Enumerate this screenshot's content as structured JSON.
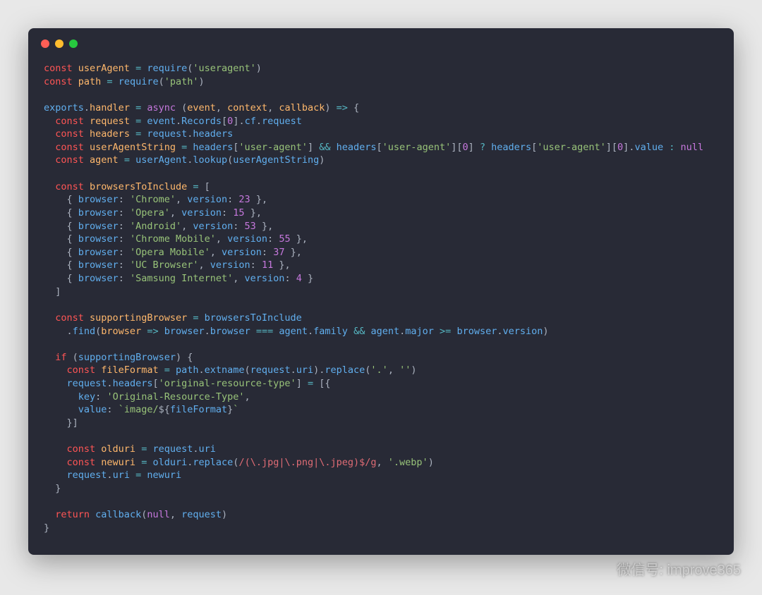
{
  "code": {
    "lines": [
      [
        {
          "c": "k",
          "t": "const "
        },
        {
          "c": "n",
          "t": "userAgent"
        },
        {
          "c": "o",
          "t": " = "
        },
        {
          "c": "b",
          "t": "require"
        },
        {
          "c": "c",
          "t": "("
        },
        {
          "c": "s",
          "t": "'useragent'"
        },
        {
          "c": "c",
          "t": ")"
        }
      ],
      [
        {
          "c": "k",
          "t": "const "
        },
        {
          "c": "n",
          "t": "path"
        },
        {
          "c": "o",
          "t": " = "
        },
        {
          "c": "b",
          "t": "require"
        },
        {
          "c": "c",
          "t": "("
        },
        {
          "c": "s",
          "t": "'path'"
        },
        {
          "c": "c",
          "t": ")"
        }
      ],
      [],
      [
        {
          "c": "b",
          "t": "exports"
        },
        {
          "c": "c",
          "t": "."
        },
        {
          "c": "n",
          "t": "handler"
        },
        {
          "c": "o",
          "t": " = "
        },
        {
          "c": "v",
          "t": "async"
        },
        {
          "c": "c",
          "t": " ("
        },
        {
          "c": "n",
          "t": "event"
        },
        {
          "c": "c",
          "t": ", "
        },
        {
          "c": "n",
          "t": "context"
        },
        {
          "c": "c",
          "t": ", "
        },
        {
          "c": "n",
          "t": "callback"
        },
        {
          "c": "c",
          "t": ") "
        },
        {
          "c": "o",
          "t": "=>"
        },
        {
          "c": "c",
          "t": " {"
        }
      ],
      [
        {
          "c": "c",
          "t": "  "
        },
        {
          "c": "k",
          "t": "const "
        },
        {
          "c": "n",
          "t": "request"
        },
        {
          "c": "o",
          "t": " = "
        },
        {
          "c": "b",
          "t": "event"
        },
        {
          "c": "c",
          "t": "."
        },
        {
          "c": "b",
          "t": "Records"
        },
        {
          "c": "c",
          "t": "["
        },
        {
          "c": "v",
          "t": "0"
        },
        {
          "c": "c",
          "t": "]."
        },
        {
          "c": "b",
          "t": "cf"
        },
        {
          "c": "c",
          "t": "."
        },
        {
          "c": "b",
          "t": "request"
        }
      ],
      [
        {
          "c": "c",
          "t": "  "
        },
        {
          "c": "k",
          "t": "const "
        },
        {
          "c": "n",
          "t": "headers"
        },
        {
          "c": "o",
          "t": " = "
        },
        {
          "c": "b",
          "t": "request"
        },
        {
          "c": "c",
          "t": "."
        },
        {
          "c": "b",
          "t": "headers"
        }
      ],
      [
        {
          "c": "c",
          "t": "  "
        },
        {
          "c": "k",
          "t": "const "
        },
        {
          "c": "n",
          "t": "userAgentString"
        },
        {
          "c": "o",
          "t": " = "
        },
        {
          "c": "b",
          "t": "headers"
        },
        {
          "c": "c",
          "t": "["
        },
        {
          "c": "s",
          "t": "'user-agent'"
        },
        {
          "c": "c",
          "t": "] "
        },
        {
          "c": "o",
          "t": "&&"
        },
        {
          "c": "c",
          "t": " "
        },
        {
          "c": "b",
          "t": "headers"
        },
        {
          "c": "c",
          "t": "["
        },
        {
          "c": "s",
          "t": "'user-agent'"
        },
        {
          "c": "c",
          "t": "]["
        },
        {
          "c": "v",
          "t": "0"
        },
        {
          "c": "c",
          "t": "] "
        },
        {
          "c": "o",
          "t": "?"
        },
        {
          "c": "c",
          "t": " "
        },
        {
          "c": "b",
          "t": "headers"
        },
        {
          "c": "c",
          "t": "["
        },
        {
          "c": "s",
          "t": "'user-agent'"
        },
        {
          "c": "c",
          "t": "]["
        },
        {
          "c": "v",
          "t": "0"
        },
        {
          "c": "c",
          "t": "]."
        },
        {
          "c": "b",
          "t": "value"
        },
        {
          "c": "c",
          "t": " "
        },
        {
          "c": "o",
          "t": ":"
        },
        {
          "c": "c",
          "t": " "
        },
        {
          "c": "v",
          "t": "null"
        }
      ],
      [
        {
          "c": "c",
          "t": "  "
        },
        {
          "c": "k",
          "t": "const "
        },
        {
          "c": "n",
          "t": "agent"
        },
        {
          "c": "o",
          "t": " = "
        },
        {
          "c": "b",
          "t": "userAgent"
        },
        {
          "c": "c",
          "t": "."
        },
        {
          "c": "b",
          "t": "lookup"
        },
        {
          "c": "c",
          "t": "("
        },
        {
          "c": "b",
          "t": "userAgentString"
        },
        {
          "c": "c",
          "t": ")"
        }
      ],
      [],
      [
        {
          "c": "c",
          "t": "  "
        },
        {
          "c": "k",
          "t": "const "
        },
        {
          "c": "n",
          "t": "browsersToInclude"
        },
        {
          "c": "o",
          "t": " = "
        },
        {
          "c": "c",
          "t": "["
        }
      ],
      [
        {
          "c": "c",
          "t": "    { "
        },
        {
          "c": "b",
          "t": "browser"
        },
        {
          "c": "c",
          "t": ": "
        },
        {
          "c": "s",
          "t": "'Chrome'"
        },
        {
          "c": "c",
          "t": ", "
        },
        {
          "c": "b",
          "t": "version"
        },
        {
          "c": "c",
          "t": ": "
        },
        {
          "c": "v",
          "t": "23"
        },
        {
          "c": "c",
          "t": " },"
        }
      ],
      [
        {
          "c": "c",
          "t": "    { "
        },
        {
          "c": "b",
          "t": "browser"
        },
        {
          "c": "c",
          "t": ": "
        },
        {
          "c": "s",
          "t": "'Opera'"
        },
        {
          "c": "c",
          "t": ", "
        },
        {
          "c": "b",
          "t": "version"
        },
        {
          "c": "c",
          "t": ": "
        },
        {
          "c": "v",
          "t": "15"
        },
        {
          "c": "c",
          "t": " },"
        }
      ],
      [
        {
          "c": "c",
          "t": "    { "
        },
        {
          "c": "b",
          "t": "browser"
        },
        {
          "c": "c",
          "t": ": "
        },
        {
          "c": "s",
          "t": "'Android'"
        },
        {
          "c": "c",
          "t": ", "
        },
        {
          "c": "b",
          "t": "version"
        },
        {
          "c": "c",
          "t": ": "
        },
        {
          "c": "v",
          "t": "53"
        },
        {
          "c": "c",
          "t": " },"
        }
      ],
      [
        {
          "c": "c",
          "t": "    { "
        },
        {
          "c": "b",
          "t": "browser"
        },
        {
          "c": "c",
          "t": ": "
        },
        {
          "c": "s",
          "t": "'Chrome Mobile'"
        },
        {
          "c": "c",
          "t": ", "
        },
        {
          "c": "b",
          "t": "version"
        },
        {
          "c": "c",
          "t": ": "
        },
        {
          "c": "v",
          "t": "55"
        },
        {
          "c": "c",
          "t": " },"
        }
      ],
      [
        {
          "c": "c",
          "t": "    { "
        },
        {
          "c": "b",
          "t": "browser"
        },
        {
          "c": "c",
          "t": ": "
        },
        {
          "c": "s",
          "t": "'Opera Mobile'"
        },
        {
          "c": "c",
          "t": ", "
        },
        {
          "c": "b",
          "t": "version"
        },
        {
          "c": "c",
          "t": ": "
        },
        {
          "c": "v",
          "t": "37"
        },
        {
          "c": "c",
          "t": " },"
        }
      ],
      [
        {
          "c": "c",
          "t": "    { "
        },
        {
          "c": "b",
          "t": "browser"
        },
        {
          "c": "c",
          "t": ": "
        },
        {
          "c": "s",
          "t": "'UC Browser'"
        },
        {
          "c": "c",
          "t": ", "
        },
        {
          "c": "b",
          "t": "version"
        },
        {
          "c": "c",
          "t": ": "
        },
        {
          "c": "v",
          "t": "11"
        },
        {
          "c": "c",
          "t": " },"
        }
      ],
      [
        {
          "c": "c",
          "t": "    { "
        },
        {
          "c": "b",
          "t": "browser"
        },
        {
          "c": "c",
          "t": ": "
        },
        {
          "c": "s",
          "t": "'Samsung Internet'"
        },
        {
          "c": "c",
          "t": ", "
        },
        {
          "c": "b",
          "t": "version"
        },
        {
          "c": "c",
          "t": ": "
        },
        {
          "c": "v",
          "t": "4"
        },
        {
          "c": "c",
          "t": " }"
        }
      ],
      [
        {
          "c": "c",
          "t": "  ]"
        }
      ],
      [],
      [
        {
          "c": "c",
          "t": "  "
        },
        {
          "c": "k",
          "t": "const "
        },
        {
          "c": "n",
          "t": "supportingBrowser"
        },
        {
          "c": "o",
          "t": " = "
        },
        {
          "c": "b",
          "t": "browsersToInclude"
        }
      ],
      [
        {
          "c": "c",
          "t": "    ."
        },
        {
          "c": "b",
          "t": "find"
        },
        {
          "c": "c",
          "t": "("
        },
        {
          "c": "n",
          "t": "browser"
        },
        {
          "c": "c",
          "t": " "
        },
        {
          "c": "o",
          "t": "=>"
        },
        {
          "c": "c",
          "t": " "
        },
        {
          "c": "b",
          "t": "browser"
        },
        {
          "c": "c",
          "t": "."
        },
        {
          "c": "b",
          "t": "browser"
        },
        {
          "c": "c",
          "t": " "
        },
        {
          "c": "o",
          "t": "==="
        },
        {
          "c": "c",
          "t": " "
        },
        {
          "c": "b",
          "t": "agent"
        },
        {
          "c": "c",
          "t": "."
        },
        {
          "c": "b",
          "t": "family"
        },
        {
          "c": "c",
          "t": " "
        },
        {
          "c": "o",
          "t": "&&"
        },
        {
          "c": "c",
          "t": " "
        },
        {
          "c": "b",
          "t": "agent"
        },
        {
          "c": "c",
          "t": "."
        },
        {
          "c": "b",
          "t": "major"
        },
        {
          "c": "c",
          "t": " "
        },
        {
          "c": "o",
          "t": ">="
        },
        {
          "c": "c",
          "t": " "
        },
        {
          "c": "b",
          "t": "browser"
        },
        {
          "c": "c",
          "t": "."
        },
        {
          "c": "b",
          "t": "version"
        },
        {
          "c": "c",
          "t": ")"
        }
      ],
      [],
      [
        {
          "c": "c",
          "t": "  "
        },
        {
          "c": "k",
          "t": "if"
        },
        {
          "c": "c",
          "t": " ("
        },
        {
          "c": "b",
          "t": "supportingBrowser"
        },
        {
          "c": "c",
          "t": ") {"
        }
      ],
      [
        {
          "c": "c",
          "t": "    "
        },
        {
          "c": "k",
          "t": "const "
        },
        {
          "c": "n",
          "t": "fileFormat"
        },
        {
          "c": "o",
          "t": " = "
        },
        {
          "c": "b",
          "t": "path"
        },
        {
          "c": "c",
          "t": "."
        },
        {
          "c": "b",
          "t": "extname"
        },
        {
          "c": "c",
          "t": "("
        },
        {
          "c": "b",
          "t": "request"
        },
        {
          "c": "c",
          "t": "."
        },
        {
          "c": "b",
          "t": "uri"
        },
        {
          "c": "c",
          "t": ")."
        },
        {
          "c": "b",
          "t": "replace"
        },
        {
          "c": "c",
          "t": "("
        },
        {
          "c": "s",
          "t": "'.'"
        },
        {
          "c": "c",
          "t": ", "
        },
        {
          "c": "s",
          "t": "''"
        },
        {
          "c": "c",
          "t": ")"
        }
      ],
      [
        {
          "c": "c",
          "t": "    "
        },
        {
          "c": "b",
          "t": "request"
        },
        {
          "c": "c",
          "t": "."
        },
        {
          "c": "b",
          "t": "headers"
        },
        {
          "c": "c",
          "t": "["
        },
        {
          "c": "s",
          "t": "'original-resource-type'"
        },
        {
          "c": "c",
          "t": "] "
        },
        {
          "c": "o",
          "t": "="
        },
        {
          "c": "c",
          "t": " [{"
        }
      ],
      [
        {
          "c": "c",
          "t": "      "
        },
        {
          "c": "b",
          "t": "key"
        },
        {
          "c": "c",
          "t": ": "
        },
        {
          "c": "s",
          "t": "'Original-Resource-Type'"
        },
        {
          "c": "c",
          "t": ","
        }
      ],
      [
        {
          "c": "c",
          "t": "      "
        },
        {
          "c": "b",
          "t": "value"
        },
        {
          "c": "c",
          "t": ": "
        },
        {
          "c": "s",
          "t": "`image/"
        },
        {
          "c": "c",
          "t": "${"
        },
        {
          "c": "b",
          "t": "fileFormat"
        },
        {
          "c": "c",
          "t": "}"
        },
        {
          "c": "s",
          "t": "`"
        }
      ],
      [
        {
          "c": "c",
          "t": "    }]"
        }
      ],
      [],
      [
        {
          "c": "c",
          "t": "    "
        },
        {
          "c": "k",
          "t": "const "
        },
        {
          "c": "n",
          "t": "olduri"
        },
        {
          "c": "o",
          "t": " = "
        },
        {
          "c": "b",
          "t": "request"
        },
        {
          "c": "c",
          "t": "."
        },
        {
          "c": "b",
          "t": "uri"
        }
      ],
      [
        {
          "c": "c",
          "t": "    "
        },
        {
          "c": "k",
          "t": "const "
        },
        {
          "c": "n",
          "t": "newuri"
        },
        {
          "c": "o",
          "t": " = "
        },
        {
          "c": "b",
          "t": "olduri"
        },
        {
          "c": "c",
          "t": "."
        },
        {
          "c": "b",
          "t": "replace"
        },
        {
          "c": "c",
          "t": "("
        },
        {
          "c": "r",
          "t": "/(\\.jpg|\\.png|\\.jpeg)$/g"
        },
        {
          "c": "c",
          "t": ", "
        },
        {
          "c": "s",
          "t": "'.webp'"
        },
        {
          "c": "c",
          "t": ")"
        }
      ],
      [
        {
          "c": "c",
          "t": "    "
        },
        {
          "c": "b",
          "t": "request"
        },
        {
          "c": "c",
          "t": "."
        },
        {
          "c": "b",
          "t": "uri"
        },
        {
          "c": "o",
          "t": " = "
        },
        {
          "c": "b",
          "t": "newuri"
        }
      ],
      [
        {
          "c": "c",
          "t": "  }"
        }
      ],
      [],
      [
        {
          "c": "c",
          "t": "  "
        },
        {
          "c": "k",
          "t": "return "
        },
        {
          "c": "b",
          "t": "callback"
        },
        {
          "c": "c",
          "t": "("
        },
        {
          "c": "v",
          "t": "null"
        },
        {
          "c": "c",
          "t": ", "
        },
        {
          "c": "b",
          "t": "request"
        },
        {
          "c": "c",
          "t": ")"
        }
      ],
      [
        {
          "c": "c",
          "t": "}"
        }
      ]
    ]
  },
  "watermark": "微信号: improve365"
}
